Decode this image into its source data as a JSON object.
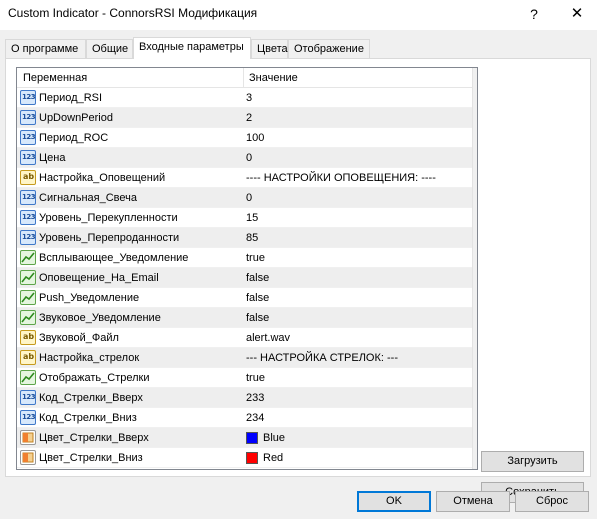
{
  "window": {
    "title": "Custom Indicator - ConnorsRSI Модификация",
    "help_glyph": "?",
    "close_glyph": "✕"
  },
  "tabs": [
    {
      "label": "О программе"
    },
    {
      "label": "Общие"
    },
    {
      "label": "Входные параметры"
    },
    {
      "label": "Цвета"
    },
    {
      "label": "Отображение"
    }
  ],
  "active_tab": "Входные параметры",
  "grid": {
    "col_variable": "Переменная",
    "col_value": "Значение",
    "rows": [
      {
        "type": "number",
        "name": "Период_RSI",
        "value": "3"
      },
      {
        "type": "number",
        "name": "UpDownPeriod",
        "value": "2"
      },
      {
        "type": "number",
        "name": "Период_ROC",
        "value": "100"
      },
      {
        "type": "number",
        "name": "Цена",
        "value": "0"
      },
      {
        "type": "string",
        "name": "Настройка_Оповещений",
        "value": "---- НАСТРОЙКИ ОПОВЕЩЕНИЯ: ----"
      },
      {
        "type": "number",
        "name": "Сигнальная_Свеча",
        "value": "0"
      },
      {
        "type": "number",
        "name": "Уровень_Перекупленности",
        "value": "15"
      },
      {
        "type": "number",
        "name": "Уровень_Перепроданности",
        "value": "85"
      },
      {
        "type": "bool",
        "name": "Всплывающее_Уведомление",
        "value": "true"
      },
      {
        "type": "bool",
        "name": "Оповещение_На_Email",
        "value": "false"
      },
      {
        "type": "bool",
        "name": "Push_Уведомление",
        "value": "false"
      },
      {
        "type": "bool",
        "name": "Звуковое_Уведомление",
        "value": "false"
      },
      {
        "type": "string",
        "name": "Звуковой_Файл",
        "value": "alert.wav"
      },
      {
        "type": "string",
        "name": "Настройка_стрелок",
        "value": "--- НАСТРОЙКА СТРЕЛОК: ---"
      },
      {
        "type": "bool",
        "name": "Отображать_Стрелки",
        "value": "true"
      },
      {
        "type": "number",
        "name": "Код_Стрелки_Вверх",
        "value": "233"
      },
      {
        "type": "number",
        "name": "Код_Стрелки_Вниз",
        "value": "234"
      },
      {
        "type": "color",
        "name": "Цвет_Стрелки_Вверх",
        "value": "Blue",
        "swatch": "#0000ff"
      },
      {
        "type": "color",
        "name": "Цвет_Стрелки_Вниз",
        "value": "Red",
        "swatch": "#ff0000"
      }
    ]
  },
  "side_buttons": {
    "load": "Загрузить",
    "save": "Сохранить"
  },
  "footer_buttons": {
    "ok": "OK",
    "cancel": "Отмена",
    "reset": "Сброс"
  },
  "icon_labels": {
    "number": "123",
    "string": "ab"
  }
}
